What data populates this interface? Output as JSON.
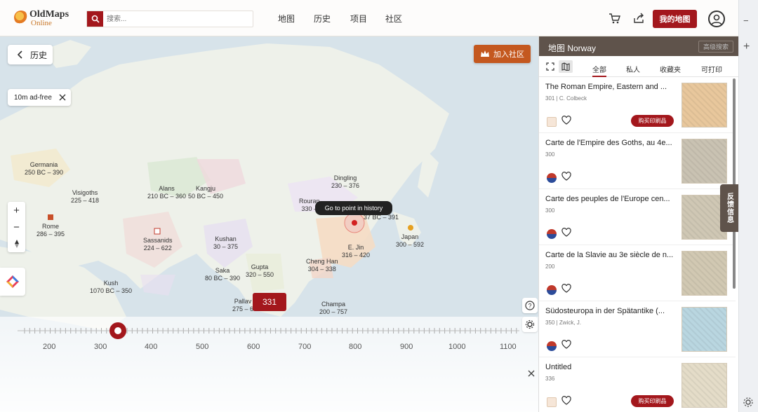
{
  "header": {
    "logo_title": "OldMaps",
    "logo_sub": "Online",
    "search_placeholder": "搜索...",
    "nav": [
      "地图",
      "历史",
      "项目",
      "社区"
    ],
    "my_map": "我的地图",
    "icons": [
      "search-icon",
      "cart-icon",
      "share-icon",
      "user-icon"
    ]
  },
  "map": {
    "back_label": "历史",
    "adfree_label": "10m ad-free",
    "join_label": "加入社区",
    "tooltip": "Go to point in history",
    "year_badge": "331",
    "labels": [
      {
        "name": "Germania",
        "years": "250 BC – 390"
      },
      {
        "name": "Visigoths",
        "years": "225 – 418"
      },
      {
        "name": "Alans",
        "years": "210 BC – 360"
      },
      {
        "name": "Kangju",
        "years": "50 BC – 450"
      },
      {
        "name": "Rome",
        "years": "286 – 395"
      },
      {
        "name": "Sassanids",
        "years": "224 – 622"
      },
      {
        "name": "Kushan",
        "years": "30 – 375"
      },
      {
        "name": "Saka",
        "years": "80 BC – 390"
      },
      {
        "name": "Gupta",
        "years": "320 – 550"
      },
      {
        "name": "Kush",
        "years": "1070 BC – 350"
      },
      {
        "name": "Pallav",
        "years": "275 – 6"
      },
      {
        "name": "Dingling",
        "years": "230 – 376"
      },
      {
        "name": "Rouran",
        "years": "330 –"
      },
      {
        "name": "",
        "years": "37 BC – 391"
      },
      {
        "name": "Japan",
        "years": "300 – 592"
      },
      {
        "name": "E. Jin",
        "years": "316 – 420"
      },
      {
        "name": "Cheng Han",
        "years": "304 – 338"
      },
      {
        "name": "Champa",
        "years": "200 – 757"
      }
    ],
    "timeline_ticks": [
      "200",
      "300",
      "400",
      "500",
      "600",
      "700",
      "800",
      "900",
      "1000",
      "1100"
    ],
    "timeline_value": 331
  },
  "panel": {
    "title": "地图 Norway",
    "advanced_search": "高级搜索",
    "tabs": [
      "全部",
      "私人",
      "收藏夹",
      "可打印"
    ],
    "active_tab": "全部",
    "buy_label": "购买印刷品",
    "cards": [
      {
        "title": "The Roman Empire, Eastern and ...",
        "meta": "301 | C. Colbeck",
        "buy": true
      },
      {
        "title": "Carte de l'Empire des Goths, au 4e...",
        "meta": "300",
        "buy": false
      },
      {
        "title": "Carte des peuples de l'Europe cen...",
        "meta": "300",
        "buy": false
      },
      {
        "title": "Carte de la Slavie au 3e siècle de n...",
        "meta": "200",
        "buy": false
      },
      {
        "title": "Südosteuropa in der Spätantike (...",
        "meta": "350 | Zwick, J.",
        "buy": false
      },
      {
        "title": "Untitled",
        "meta": "336",
        "buy": true
      }
    ],
    "feedback": "反馈信息"
  }
}
